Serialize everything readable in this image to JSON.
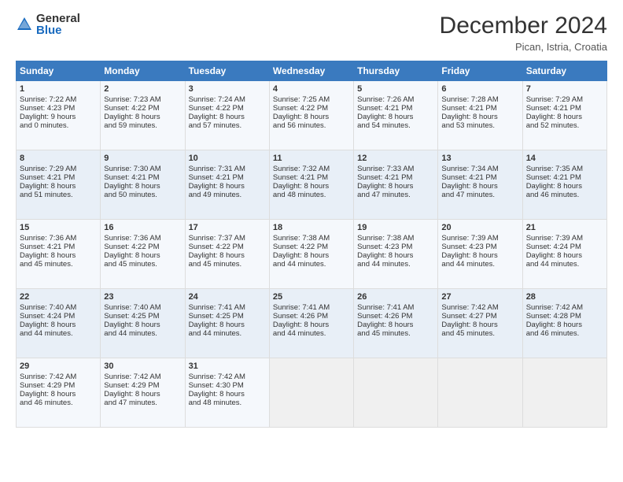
{
  "logo": {
    "general": "General",
    "blue": "Blue"
  },
  "header": {
    "month": "December 2024",
    "location": "Pican, Istria, Croatia"
  },
  "weekdays": [
    "Sunday",
    "Monday",
    "Tuesday",
    "Wednesday",
    "Thursday",
    "Friday",
    "Saturday"
  ],
  "rows": [
    [
      {
        "day": "1",
        "lines": [
          "Sunrise: 7:22 AM",
          "Sunset: 4:23 PM",
          "Daylight: 9 hours",
          "and 0 minutes."
        ]
      },
      {
        "day": "2",
        "lines": [
          "Sunrise: 7:23 AM",
          "Sunset: 4:22 PM",
          "Daylight: 8 hours",
          "and 59 minutes."
        ]
      },
      {
        "day": "3",
        "lines": [
          "Sunrise: 7:24 AM",
          "Sunset: 4:22 PM",
          "Daylight: 8 hours",
          "and 57 minutes."
        ]
      },
      {
        "day": "4",
        "lines": [
          "Sunrise: 7:25 AM",
          "Sunset: 4:22 PM",
          "Daylight: 8 hours",
          "and 56 minutes."
        ]
      },
      {
        "day": "5",
        "lines": [
          "Sunrise: 7:26 AM",
          "Sunset: 4:21 PM",
          "Daylight: 8 hours",
          "and 54 minutes."
        ]
      },
      {
        "day": "6",
        "lines": [
          "Sunrise: 7:28 AM",
          "Sunset: 4:21 PM",
          "Daylight: 8 hours",
          "and 53 minutes."
        ]
      },
      {
        "day": "7",
        "lines": [
          "Sunrise: 7:29 AM",
          "Sunset: 4:21 PM",
          "Daylight: 8 hours",
          "and 52 minutes."
        ]
      }
    ],
    [
      {
        "day": "8",
        "lines": [
          "Sunrise: 7:29 AM",
          "Sunset: 4:21 PM",
          "Daylight: 8 hours",
          "and 51 minutes."
        ]
      },
      {
        "day": "9",
        "lines": [
          "Sunrise: 7:30 AM",
          "Sunset: 4:21 PM",
          "Daylight: 8 hours",
          "and 50 minutes."
        ]
      },
      {
        "day": "10",
        "lines": [
          "Sunrise: 7:31 AM",
          "Sunset: 4:21 PM",
          "Daylight: 8 hours",
          "and 49 minutes."
        ]
      },
      {
        "day": "11",
        "lines": [
          "Sunrise: 7:32 AM",
          "Sunset: 4:21 PM",
          "Daylight: 8 hours",
          "and 48 minutes."
        ]
      },
      {
        "day": "12",
        "lines": [
          "Sunrise: 7:33 AM",
          "Sunset: 4:21 PM",
          "Daylight: 8 hours",
          "and 47 minutes."
        ]
      },
      {
        "day": "13",
        "lines": [
          "Sunrise: 7:34 AM",
          "Sunset: 4:21 PM",
          "Daylight: 8 hours",
          "and 47 minutes."
        ]
      },
      {
        "day": "14",
        "lines": [
          "Sunrise: 7:35 AM",
          "Sunset: 4:21 PM",
          "Daylight: 8 hours",
          "and 46 minutes."
        ]
      }
    ],
    [
      {
        "day": "15",
        "lines": [
          "Sunrise: 7:36 AM",
          "Sunset: 4:21 PM",
          "Daylight: 8 hours",
          "and 45 minutes."
        ]
      },
      {
        "day": "16",
        "lines": [
          "Sunrise: 7:36 AM",
          "Sunset: 4:22 PM",
          "Daylight: 8 hours",
          "and 45 minutes."
        ]
      },
      {
        "day": "17",
        "lines": [
          "Sunrise: 7:37 AM",
          "Sunset: 4:22 PM",
          "Daylight: 8 hours",
          "and 45 minutes."
        ]
      },
      {
        "day": "18",
        "lines": [
          "Sunrise: 7:38 AM",
          "Sunset: 4:22 PM",
          "Daylight: 8 hours",
          "and 44 minutes."
        ]
      },
      {
        "day": "19",
        "lines": [
          "Sunrise: 7:38 AM",
          "Sunset: 4:23 PM",
          "Daylight: 8 hours",
          "and 44 minutes."
        ]
      },
      {
        "day": "20",
        "lines": [
          "Sunrise: 7:39 AM",
          "Sunset: 4:23 PM",
          "Daylight: 8 hours",
          "and 44 minutes."
        ]
      },
      {
        "day": "21",
        "lines": [
          "Sunrise: 7:39 AM",
          "Sunset: 4:24 PM",
          "Daylight: 8 hours",
          "and 44 minutes."
        ]
      }
    ],
    [
      {
        "day": "22",
        "lines": [
          "Sunrise: 7:40 AM",
          "Sunset: 4:24 PM",
          "Daylight: 8 hours",
          "and 44 minutes."
        ]
      },
      {
        "day": "23",
        "lines": [
          "Sunrise: 7:40 AM",
          "Sunset: 4:25 PM",
          "Daylight: 8 hours",
          "and 44 minutes."
        ]
      },
      {
        "day": "24",
        "lines": [
          "Sunrise: 7:41 AM",
          "Sunset: 4:25 PM",
          "Daylight: 8 hours",
          "and 44 minutes."
        ]
      },
      {
        "day": "25",
        "lines": [
          "Sunrise: 7:41 AM",
          "Sunset: 4:26 PM",
          "Daylight: 8 hours",
          "and 44 minutes."
        ]
      },
      {
        "day": "26",
        "lines": [
          "Sunrise: 7:41 AM",
          "Sunset: 4:26 PM",
          "Daylight: 8 hours",
          "and 45 minutes."
        ]
      },
      {
        "day": "27",
        "lines": [
          "Sunrise: 7:42 AM",
          "Sunset: 4:27 PM",
          "Daylight: 8 hours",
          "and 45 minutes."
        ]
      },
      {
        "day": "28",
        "lines": [
          "Sunrise: 7:42 AM",
          "Sunset: 4:28 PM",
          "Daylight: 8 hours",
          "and 46 minutes."
        ]
      }
    ],
    [
      {
        "day": "29",
        "lines": [
          "Sunrise: 7:42 AM",
          "Sunset: 4:29 PM",
          "Daylight: 8 hours",
          "and 46 minutes."
        ]
      },
      {
        "day": "30",
        "lines": [
          "Sunrise: 7:42 AM",
          "Sunset: 4:29 PM",
          "Daylight: 8 hours",
          "and 47 minutes."
        ]
      },
      {
        "day": "31",
        "lines": [
          "Sunrise: 7:42 AM",
          "Sunset: 4:30 PM",
          "Daylight: 8 hours",
          "and 48 minutes."
        ]
      },
      null,
      null,
      null,
      null
    ]
  ]
}
